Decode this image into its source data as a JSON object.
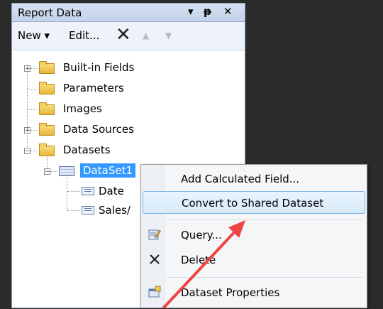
{
  "panel": {
    "title": "Report Data",
    "pin_glyph": "▾",
    "dock_glyph": "ᅟ"
  },
  "toolbar": {
    "new_label": "New ▾",
    "edit_label": "Edit...",
    "delete_glyph": "✕",
    "up_glyph": "▲",
    "down_glyph": "▼"
  },
  "tree": {
    "items": [
      {
        "label": "Built-in Fields"
      },
      {
        "label": "Parameters"
      },
      {
        "label": "Images"
      },
      {
        "label": "Data Sources"
      },
      {
        "label": "Datasets"
      }
    ],
    "dataset": {
      "label": "DataSet1"
    },
    "fields": [
      {
        "label": "Date"
      },
      {
        "label": "Sales/"
      }
    ]
  },
  "context_menu": {
    "items": [
      {
        "label": "Add Calculated Field..."
      },
      {
        "label": "Convert to Shared Dataset"
      },
      {
        "label": "Query..."
      },
      {
        "label": "Delete"
      },
      {
        "label": "Dataset Properties"
      }
    ]
  },
  "colors": {
    "selection": "#3399ff",
    "menu_hover_border": "#7fb4e6",
    "annotation_arrow": "#ef4444"
  },
  "icons": [
    "expand-icon",
    "collapse-icon",
    "folder-icon",
    "dataset-icon",
    "field-icon",
    "query-icon",
    "delete-icon",
    "properties-icon",
    "arrow-annotation"
  ]
}
